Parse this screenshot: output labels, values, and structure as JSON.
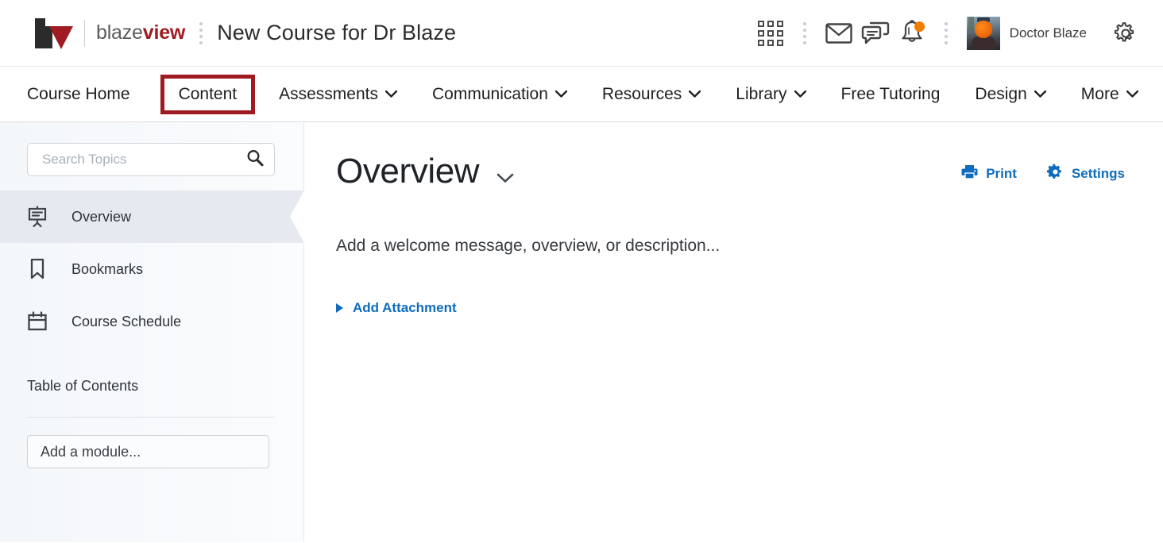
{
  "header": {
    "logo": {
      "part1": "blaze",
      "part2": "view",
      "mark": "lv-logo-icon"
    },
    "course_title": "New Course for Dr Blaze",
    "icons": [
      {
        "name": "waffle-grid-icon",
        "label": "Apps"
      },
      {
        "name": "envelope-icon",
        "label": "Email"
      },
      {
        "name": "chat-bubbles-icon",
        "label": "Messages"
      },
      {
        "name": "bell-icon",
        "label": "Notifications",
        "badge": true,
        "badge_color": "#f07d00"
      }
    ],
    "user_name": "Doctor Blaze",
    "avatar_alt": "user-avatar",
    "settings_icon": "gear-icon"
  },
  "nav": {
    "items": [
      {
        "label": "Course Home",
        "caret": false,
        "highlighted": false
      },
      {
        "label": "Content",
        "caret": false,
        "highlighted": true
      },
      {
        "label": "Assessments",
        "caret": true,
        "highlighted": false
      },
      {
        "label": "Communication",
        "caret": true,
        "highlighted": false
      },
      {
        "label": "Resources",
        "caret": true,
        "highlighted": false
      },
      {
        "label": "Library",
        "caret": true,
        "highlighted": false
      },
      {
        "label": "Free Tutoring",
        "caret": false,
        "highlighted": false
      },
      {
        "label": "Design",
        "caret": true,
        "highlighted": false
      },
      {
        "label": "More",
        "caret": true,
        "highlighted": false
      }
    ],
    "highlight_color": "#9e1b22"
  },
  "sidebar": {
    "search": {
      "value": "",
      "placeholder": "Search Topics",
      "icon": "search-icon"
    },
    "items": [
      {
        "label": "Overview",
        "icon": "presentation-board-icon",
        "active": true
      },
      {
        "label": "Bookmarks",
        "icon": "bookmark-icon",
        "active": false
      },
      {
        "label": "Course Schedule",
        "icon": "calendar-icon",
        "active": false
      }
    ],
    "toc_title": "Table of Contents",
    "add_module": {
      "value": "",
      "placeholder": "Add a module..."
    }
  },
  "main": {
    "title": "Overview",
    "title_caret": "chevron-down-icon",
    "actions": [
      {
        "label": "Print",
        "icon": "printer-icon",
        "color": "#0f6cbd"
      },
      {
        "label": "Settings",
        "icon": "gear-icon",
        "color": "#0f6cbd"
      }
    ],
    "welcome_placeholder": "Add a welcome message, overview, or description...",
    "add_attachment": {
      "label": "Add Attachment",
      "icon": "triangle-right-icon"
    }
  }
}
